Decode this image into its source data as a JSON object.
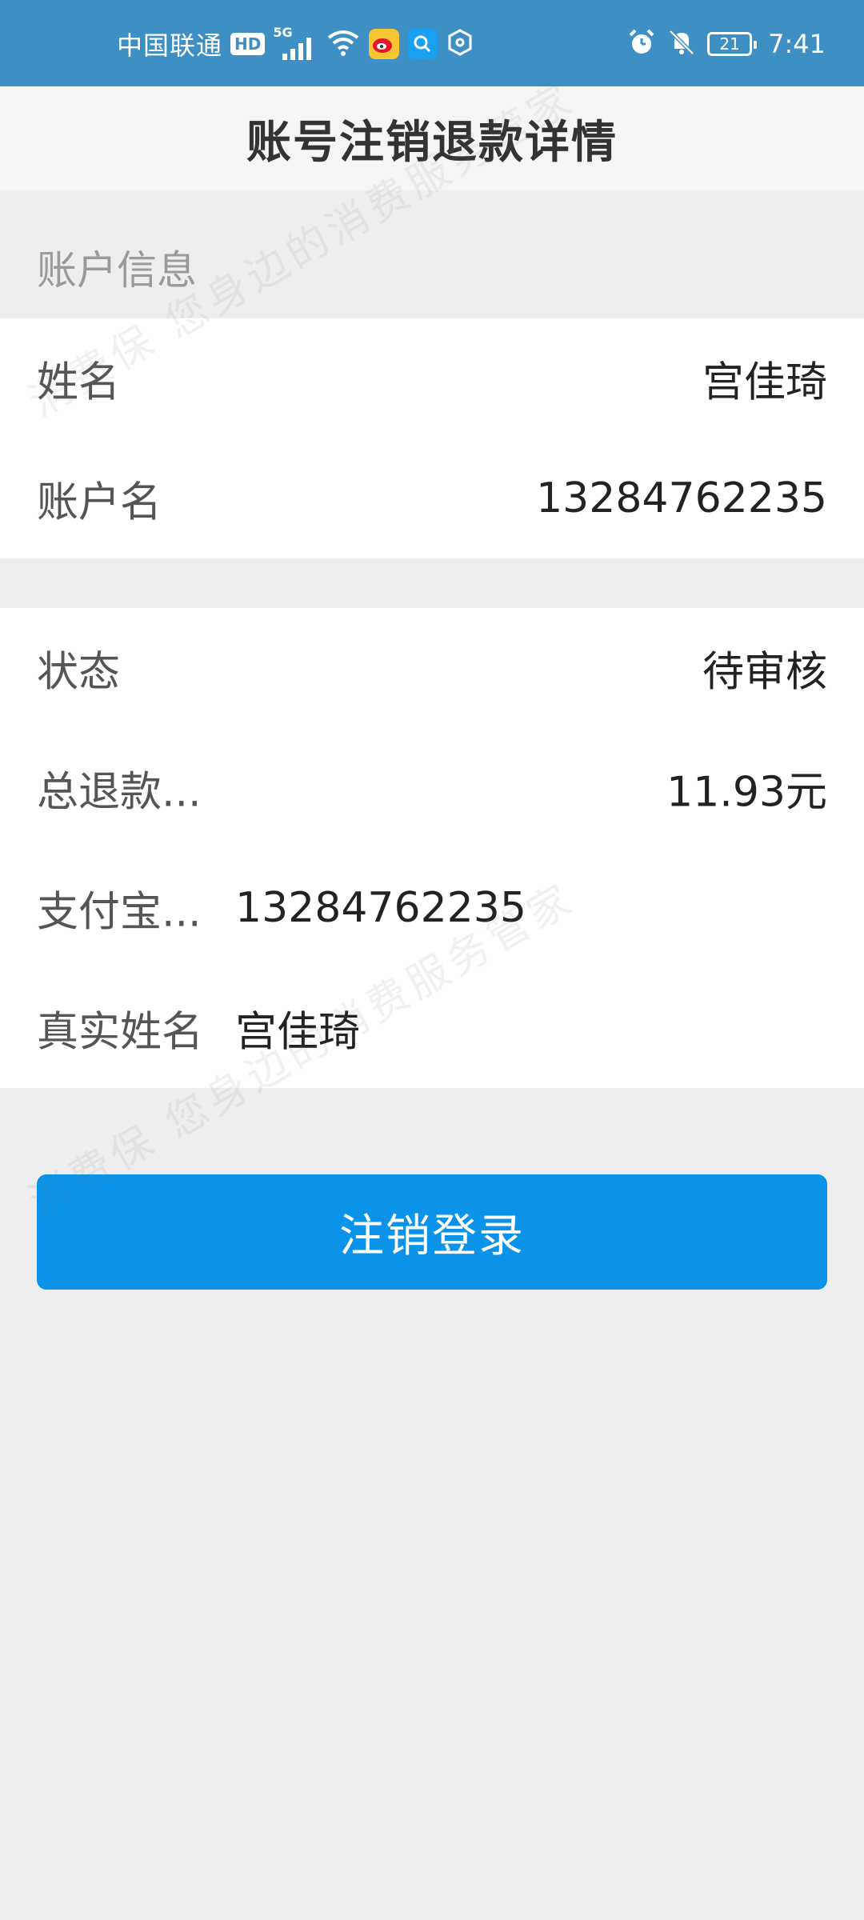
{
  "status_bar": {
    "carrier": "中国联通",
    "hd": "HD",
    "net": "5G",
    "battery": "21",
    "time": "7:41"
  },
  "header": {
    "title": "账号注销退款详情"
  },
  "section": {
    "account_info": "账户信息"
  },
  "account": {
    "name_label": "姓名",
    "name_value": "宫佳琦",
    "account_label": "账户名",
    "account_value": "13284762235"
  },
  "refund": {
    "status_label": "状态",
    "status_value": "待审核",
    "total_label": "总退款...",
    "total_value": "11.93元",
    "alipay_label": "支付宝...",
    "alipay_value": "13284762235",
    "realname_label": "真实姓名",
    "realname_value": "宫佳琦"
  },
  "actions": {
    "logout_label": "注销登录"
  },
  "watermark": {
    "text": "消费保 您身边的消费服务管家"
  },
  "colors": {
    "status_bar": "#3d8fc4",
    "button": "#0b93e9",
    "page_bg": "#eeeeee"
  }
}
